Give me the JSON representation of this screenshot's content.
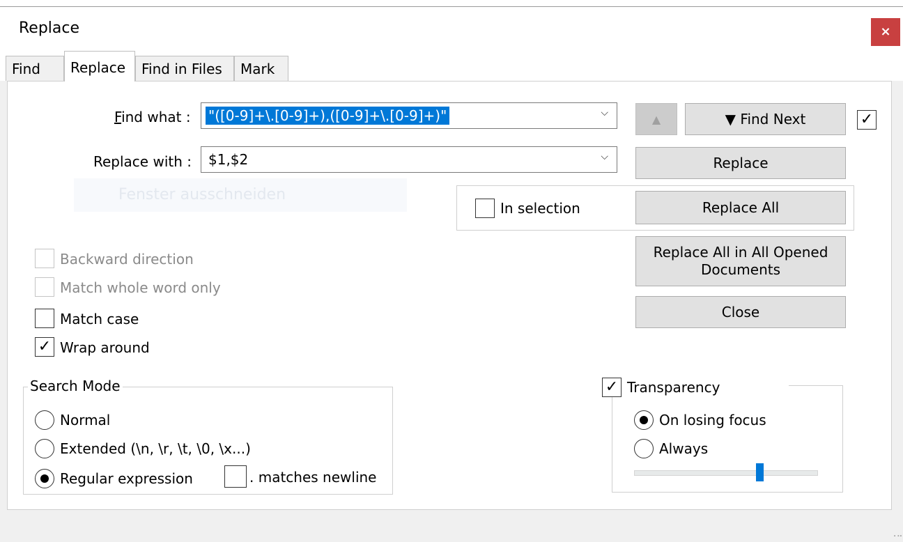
{
  "window": {
    "title": "Replace",
    "close_label": "×"
  },
  "tabs": [
    {
      "label": "Find",
      "active": false
    },
    {
      "label": "Replace",
      "active": true
    },
    {
      "label": "Find in Files",
      "active": false
    },
    {
      "label": "Mark",
      "active": false
    }
  ],
  "find": {
    "label": "Find what :",
    "value": "\"([0-9]+\\.[0-9]+),([0-9]+\\.[0-9]+)\""
  },
  "replace": {
    "label": "Replace with :",
    "value": "$1,$2"
  },
  "ghost_text": "Fenster ausschneiden",
  "buttons": {
    "find_prev": "▲",
    "find_next": "▼ Find Next",
    "replace": "Replace",
    "replace_all": "Replace All",
    "replace_all_opened_line1": "Replace All in All Opened",
    "replace_all_opened_line2": "Documents",
    "close": "Close"
  },
  "in_selection": {
    "label": "In selection",
    "checked": false
  },
  "find_next_checkbox": {
    "checked": true,
    "mark": "✓"
  },
  "options": {
    "backward": {
      "label": "Backward direction",
      "checked": false,
      "enabled": false
    },
    "whole_word": {
      "label": "Match whole word only",
      "checked": false,
      "enabled": false
    },
    "match_case": {
      "label": "Match case",
      "checked": false,
      "enabled": true
    },
    "wrap_around": {
      "label": "Wrap around",
      "checked": true,
      "enabled": true,
      "mark": "✓"
    }
  },
  "search_mode": {
    "title": "Search Mode",
    "normal": "Normal",
    "extended": "Extended (\\n, \\r, \\t, \\0, \\x...)",
    "regex": "Regular expression",
    "selected": "regex",
    "matches_newline": ". matches newline"
  },
  "transparency": {
    "label": "Transparency",
    "checked": true,
    "mark": "✓",
    "on_losing_focus": "On losing focus",
    "always": "Always",
    "selected": "on_losing_focus",
    "level_fraction": 0.69
  },
  "icons": {
    "chevron": "⌵",
    "grip": "⠠⠤"
  }
}
